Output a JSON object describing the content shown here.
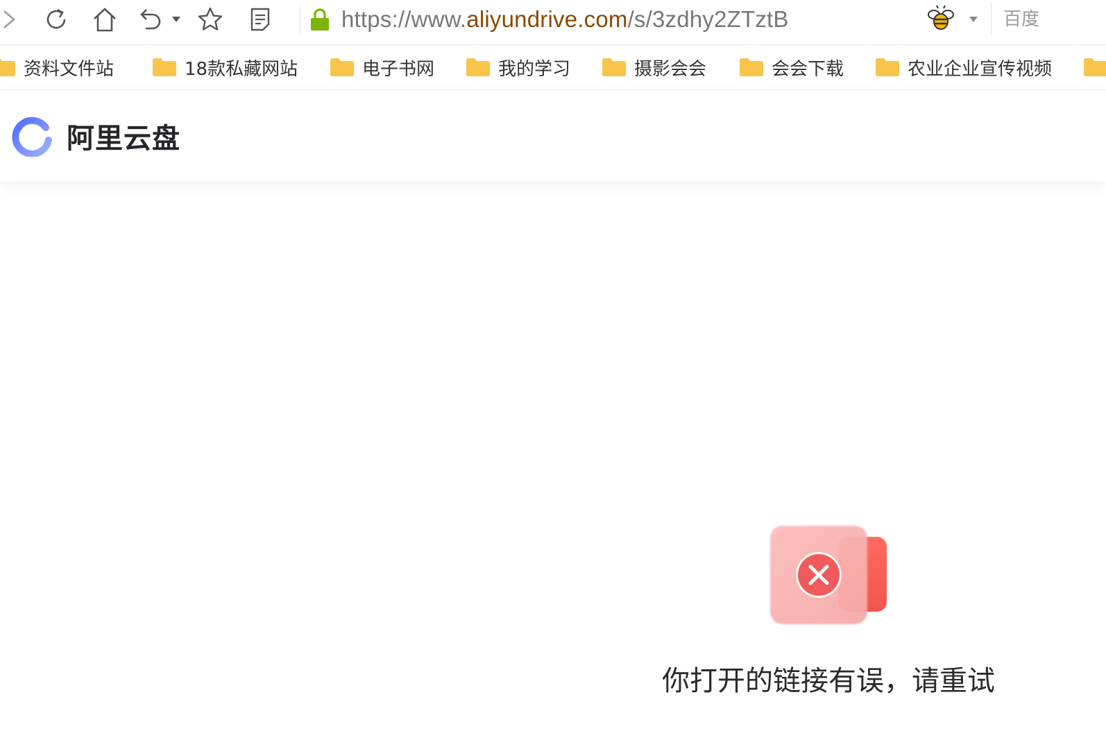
{
  "browser": {
    "url_prefix": "https://www.",
    "url_domain": "aliyundrive.com",
    "url_path": "/s/3zdhy2ZTztB",
    "search_engine": "百度",
    "icons": {
      "forward": "chevron-right-icon",
      "reload": "reload-icon",
      "home": "home-icon",
      "undo": "undo-icon",
      "undo_menu": "caret-down-icon",
      "favorite": "star-icon",
      "reader": "reader-icon",
      "secure": "lock-icon",
      "extension": "bee-icon",
      "extension_menu": "caret-down-icon"
    },
    "colors": {
      "lock": "#7cb300",
      "domain_text": "#8a4a00",
      "folder": "#f8c54a"
    }
  },
  "bookmarks": [
    {
      "label": "资料文件站"
    },
    {
      "label": "18款私藏网站"
    },
    {
      "label": "电子书网"
    },
    {
      "label": "我的学习"
    },
    {
      "label": "摄影会会"
    },
    {
      "label": "会会下载"
    },
    {
      "label": "农业企业宣传视频"
    }
  ],
  "app": {
    "name": "阿里云盘",
    "logo_icon": "aliyundrive-logo-icon",
    "brand_color": "#637dff"
  },
  "error": {
    "icon": "error-x-icon",
    "message": "你打开的链接有误，请重试",
    "color": "#f05a5a"
  }
}
